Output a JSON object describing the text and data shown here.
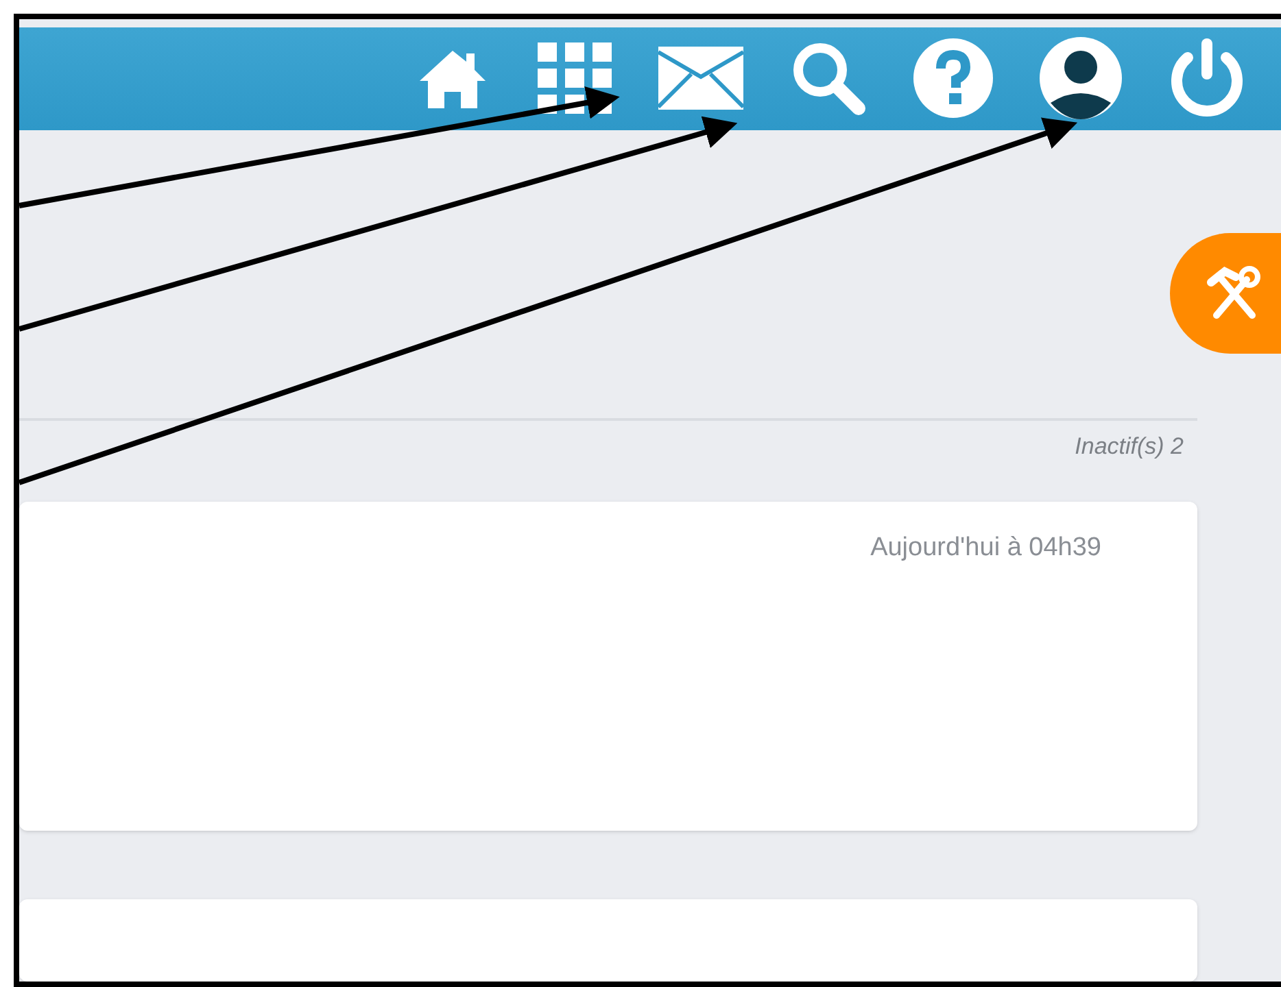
{
  "section": {
    "status": "Inactif(s) 2"
  },
  "cards": [
    {
      "time": "Aujourd'hui à 04h39"
    }
  ]
}
